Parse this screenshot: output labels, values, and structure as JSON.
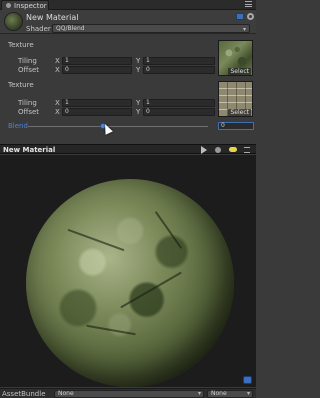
{
  "tab": {
    "title": "Inspector"
  },
  "header": {
    "material_name": "New Material",
    "shader_label": "Shader",
    "shader_value": "QQ/Blend"
  },
  "properties": {
    "texture1": {
      "label": "Texture",
      "tiling_label": "Tiling",
      "offset_label": "Offset",
      "tiling_x": "1",
      "tiling_y": "1",
      "offset_x": "0",
      "offset_y": "0",
      "select_label": "Select"
    },
    "texture2": {
      "label": "Texture",
      "tiling_label": "Tiling",
      "offset_label": "Offset",
      "tiling_x": "1",
      "tiling_y": "1",
      "offset_x": "0",
      "offset_y": "0",
      "select_label": "Select"
    },
    "axis_x": "X",
    "axis_y": "Y",
    "blend": {
      "label": "Blend",
      "value": "0",
      "fraction": 0.4
    }
  },
  "preview": {
    "title": "New Material"
  },
  "bottom": {
    "asset_bundle_label": "AssetBundle",
    "bundle_value": "None",
    "variant_value": "None"
  },
  "colors": {
    "panel": "#3a3a3a",
    "accent_blue": "#4e80d4",
    "preview_bg": "#1c1c1c"
  }
}
